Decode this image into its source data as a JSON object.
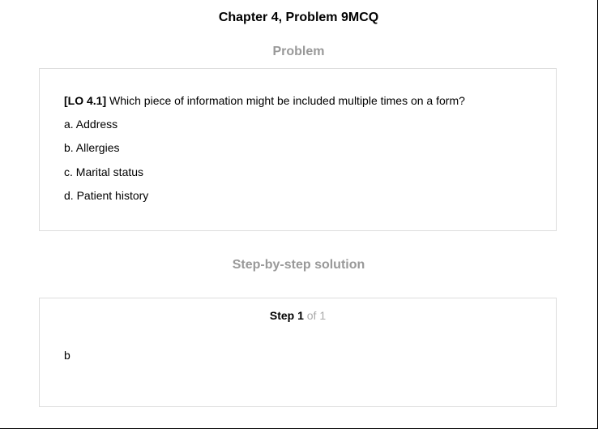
{
  "header": {
    "title": "Chapter 4, Problem 9MCQ"
  },
  "problem": {
    "heading": "Problem",
    "lo_tag": "[LO 4.1]",
    "question": " Which piece of information might be included multiple times on a form?",
    "options": [
      "a. Address",
      "b. Allergies",
      "c. Marital status",
      "d. Patient history"
    ]
  },
  "solution": {
    "heading": "Step-by-step solution",
    "step_word": "Step 1",
    "step_of": " of 1",
    "answer": "b"
  }
}
